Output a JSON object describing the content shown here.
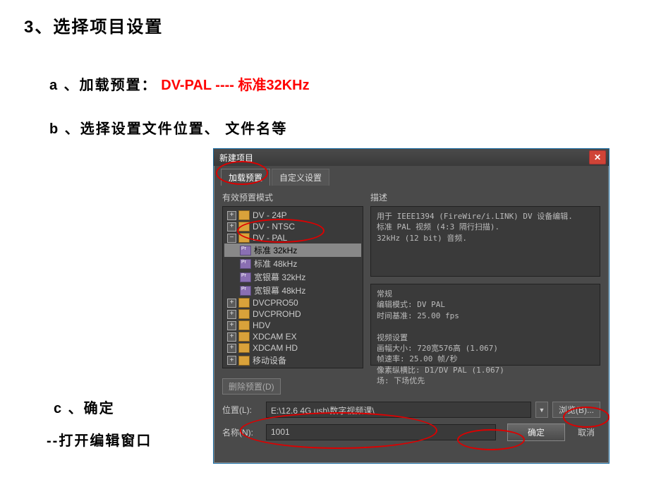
{
  "outer": {
    "heading": "3、选择项目设置",
    "line_a_prefix": "a 、加载预置：",
    "line_a_red": "DV-PAL ---- 标准32KHz",
    "line_b": "b 、选择设置文件位置、 文件名等",
    "line_c": "c 、确定",
    "line_d": "--打开编辑窗口"
  },
  "dialog": {
    "title": "新建项目",
    "close": "✕",
    "tabs": {
      "load": "加载预置",
      "custom": "自定义设置"
    },
    "left_label": "有效预置模式",
    "tree": {
      "dv24p": "DV - 24P",
      "dvntsc": "DV - NTSC",
      "dvpal": "DV - PAL",
      "std32": "标准 32kHz",
      "std48": "标准 48kHz",
      "wide32": "宽银幕 32kHz",
      "wide48": "宽银幕 48kHz",
      "dvcpro50": "DVCPRO50",
      "dvcprohd": "DVCPROHD",
      "hdv": "HDV",
      "xdcamex": "XDCAM EX",
      "xdcamhd": "XDCAM HD",
      "mobile": "移动设备"
    },
    "desc_label": "描述",
    "desc_text": "用于 IEEE1394 (FireWire/i.LINK) DV 设备编辑.\n标准 PAL 视频 (4:3 隔行扫描).\n32kHz (12 bit) 音频.",
    "general_text": "常规\n编辑模式: DV PAL\n时间基准: 25.00 fps\n\n视频设置\n画幅大小: 720宽576高 (1.067)\n帧速率: 25.00 帧/秒\n像素纵横比: D1/DV PAL (1.067)\n场: 下场优先",
    "delete_preset": "删除预置(D)",
    "location_label": "位置(L):",
    "location_value": "E:\\12.6 4G usb\\数字视频课\\",
    "browse": "浏览(B)...",
    "name_label": "名称(N):",
    "name_value": "1001",
    "ok": "确定",
    "cancel": "取消",
    "plus": "+",
    "minus": "−"
  }
}
